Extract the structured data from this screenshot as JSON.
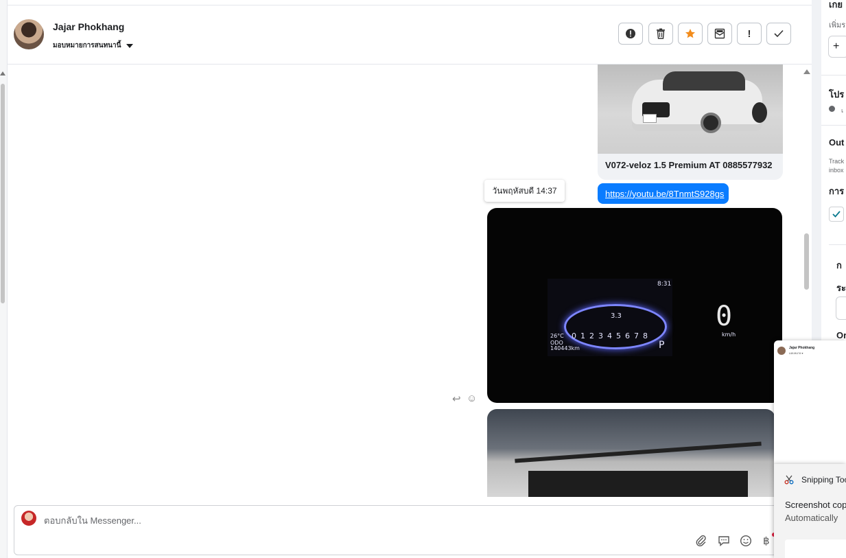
{
  "header": {
    "contact_name": "Jajar Phokhang",
    "assign_label": "มอบหมายการสนทนานี้"
  },
  "toolbar_icons": [
    "alert-circle-icon",
    "trash-icon",
    "star-icon",
    "mark-unread-icon",
    "exclamation-icon",
    "check-icon"
  ],
  "messages": {
    "car_title": "V072-veloz 1.5 Premium AT 0885577932",
    "link_text": "https://youtu.be/8TnmtS928gs",
    "timestamp_tooltip": "วันพฤหัสบดี 14:37",
    "dashboard": {
      "time": "8:31",
      "temp": "26°C",
      "odo_label": "ODO",
      "odo": "140443km",
      "speed": "0",
      "speed_unit": "km/h",
      "range": "3.3",
      "gear": "P"
    }
  },
  "composer": {
    "placeholder": "ตอบกลับใน Messenger..."
  },
  "composer_icons": [
    "attach-icon",
    "chat-bubble-icon",
    "emoji-icon",
    "baht-icon"
  ],
  "right_panel": {
    "section1_title": "เกย",
    "section1_sub": "เพิ่มร",
    "add_symbol": "+",
    "section2_title": "โปร",
    "section2_sub": "เ",
    "section3_title": "Out",
    "section3_sub1": "Track",
    "section3_sub2": "inbox",
    "section4_title": "การ",
    "section5_title": "ก",
    "section6_title": "ระ",
    "section7_title": "Or"
  },
  "preview": {
    "name": "Jajar Phokhang",
    "sub": "มอบหมาย ▾"
  },
  "snipping": {
    "title": "Snipping Too",
    "message": "Screenshot cop",
    "sub": "Automatically"
  },
  "colors": {
    "link_bubble": "#0a7cff",
    "star": "#f28c1c",
    "accent_check": "#1877f2"
  }
}
